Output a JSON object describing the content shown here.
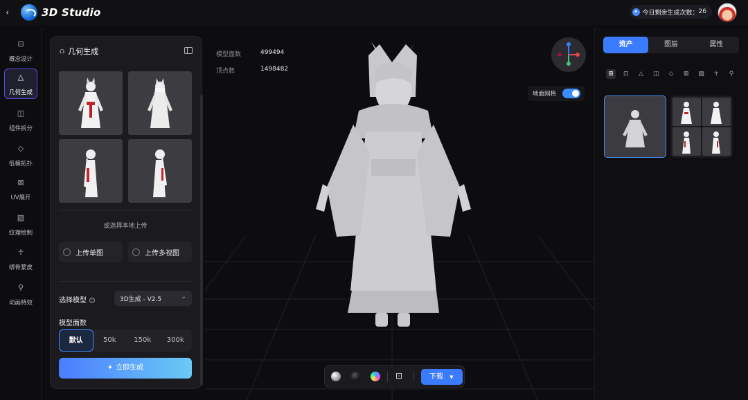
{
  "app": {
    "title": "3D Studio"
  },
  "header": {
    "quota_label": "今日剩余生成次数：",
    "quota_value": "26"
  },
  "nav": {
    "items": [
      {
        "label": "概念设计",
        "icon": "image-icon"
      },
      {
        "label": "几何生成",
        "icon": "shapes-icon"
      },
      {
        "label": "组件拆分",
        "icon": "split-icon"
      },
      {
        "label": "低模拓扑",
        "icon": "lowpoly-icon"
      },
      {
        "label": "UV展开",
        "icon": "uv-icon"
      },
      {
        "label": "纹理绘制",
        "icon": "texture-icon"
      },
      {
        "label": "绑骨蒙皮",
        "icon": "rig-icon"
      },
      {
        "label": "动画特效",
        "icon": "run-icon"
      }
    ],
    "active": "几何生成"
  },
  "panel": {
    "title": "几何生成",
    "or_upload": "或选择本地上传",
    "upload_single": "上传单图",
    "upload_multi": "上传多视图",
    "select_model_label": "选择模型",
    "model_value": "3D生成 - V2.5",
    "face_count_label": "模型面数",
    "face_options": [
      "默认",
      "50k",
      "150k",
      "300k"
    ],
    "face_selected": "默认",
    "generate_label": "立即生成"
  },
  "viewport": {
    "faces_label": "模型面数",
    "faces_value": "499494",
    "verts_label": "顶点数",
    "verts_value": "1498482",
    "grid_label": "地面网格",
    "grid_on": true,
    "download_label": "下载"
  },
  "right": {
    "tabs": [
      "资产",
      "图层",
      "属性"
    ],
    "active_tab": "资产"
  },
  "colors": {
    "accent": "#3b7bff",
    "active_nav_border": "#5a4ee0"
  }
}
